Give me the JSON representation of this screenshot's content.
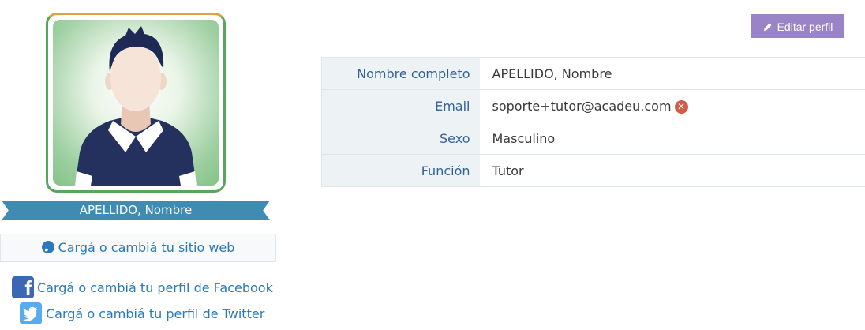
{
  "profile": {
    "display_name": "APELLIDO, Nombre",
    "avatar_icon": "user-avatar-male",
    "website_link": "Cargá o cambiá tu sitio web",
    "facebook_link": "Cargá o cambiá tu perfil de Facebook",
    "twitter_link": "Cargá o cambiá tu perfil de Twitter",
    "facebook_glyph": "f"
  },
  "toolbar": {
    "edit_label": "Editar perfil"
  },
  "details": [
    {
      "label": "Nombre completo",
      "value": "APELLIDO, Nombre"
    },
    {
      "label": "Email",
      "value": "soporte+tutor@acadeu.com"
    },
    {
      "label": "Sexo",
      "value": "Masculino"
    },
    {
      "label": "Función",
      "value": "Tutor"
    }
  ],
  "colors": {
    "accent_blue": "#2a78b8",
    "ribbon": "#3f8bb2",
    "edit_button": "#9b83c8",
    "label_text": "#336199",
    "remove": "#d15b47"
  }
}
